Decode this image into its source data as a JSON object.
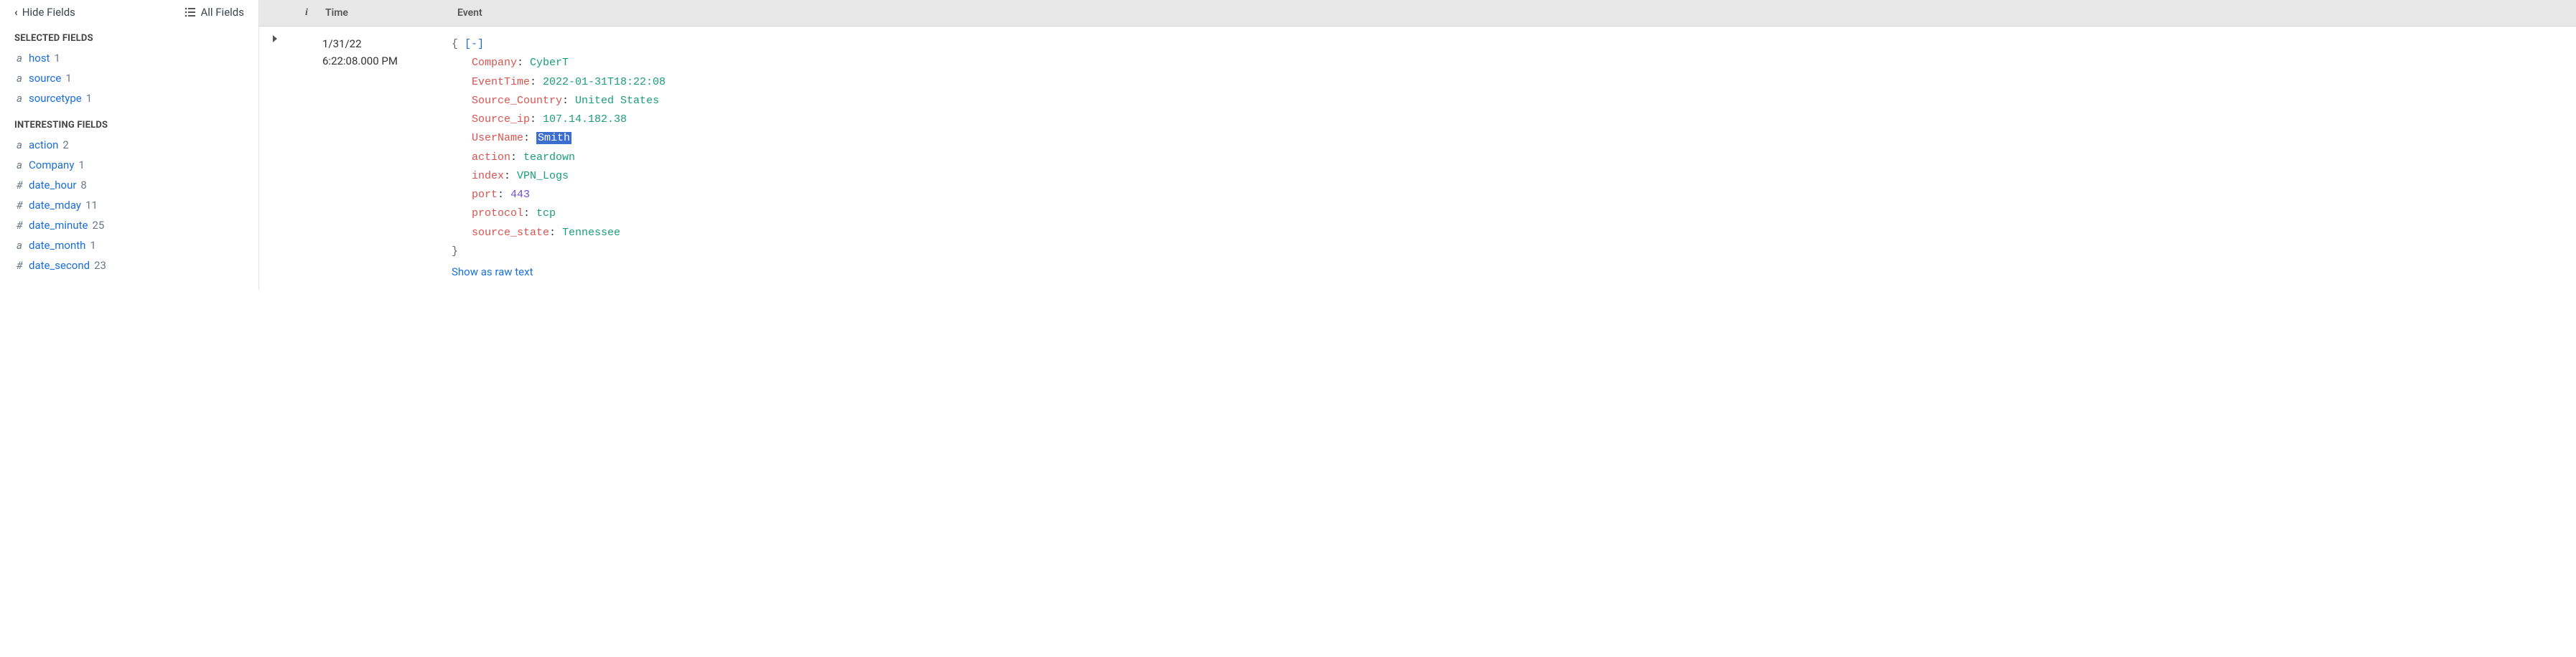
{
  "sidebar": {
    "hide_fields_label": "Hide Fields",
    "all_fields_label": "All Fields",
    "selected_title": "SELECTED FIELDS",
    "interesting_title": "INTERESTING FIELDS",
    "selected_fields": [
      {
        "type": "a",
        "name": "host",
        "count": "1"
      },
      {
        "type": "a",
        "name": "source",
        "count": "1"
      },
      {
        "type": "a",
        "name": "sourcetype",
        "count": "1"
      }
    ],
    "interesting_fields": [
      {
        "type": "a",
        "name": "action",
        "count": "2"
      },
      {
        "type": "a",
        "name": "Company",
        "count": "1"
      },
      {
        "type": "#",
        "name": "date_hour",
        "count": "8"
      },
      {
        "type": "#",
        "name": "date_mday",
        "count": "11"
      },
      {
        "type": "#",
        "name": "date_minute",
        "count": "25"
      },
      {
        "type": "a",
        "name": "date_month",
        "count": "1"
      },
      {
        "type": "#",
        "name": "date_second",
        "count": "23"
      }
    ]
  },
  "table": {
    "header_info": "i",
    "header_time": "Time",
    "header_event": "Event"
  },
  "event": {
    "date": "1/31/22",
    "time": "6:22:08.000 PM",
    "brace_open": "{",
    "toggle": "[-]",
    "brace_close": "}",
    "raw_link_label": "Show as raw text",
    "pairs": [
      {
        "key": "Company",
        "value": "CyberT",
        "kind": "str"
      },
      {
        "key": "EventTime",
        "value": "2022-01-31T18:22:08",
        "kind": "str"
      },
      {
        "key": "Source_Country",
        "value": "United States",
        "kind": "str"
      },
      {
        "key": "Source_ip",
        "value": "107.14.182.38",
        "kind": "str"
      },
      {
        "key": "UserName",
        "value": "Smith",
        "kind": "hl"
      },
      {
        "key": "action",
        "value": "teardown",
        "kind": "str"
      },
      {
        "key": "index",
        "value": "VPN_Logs",
        "kind": "str"
      },
      {
        "key": "port",
        "value": "443",
        "kind": "num"
      },
      {
        "key": "protocol",
        "value": "tcp",
        "kind": "str"
      },
      {
        "key": "source_state",
        "value": "Tennessee",
        "kind": "str"
      }
    ]
  }
}
